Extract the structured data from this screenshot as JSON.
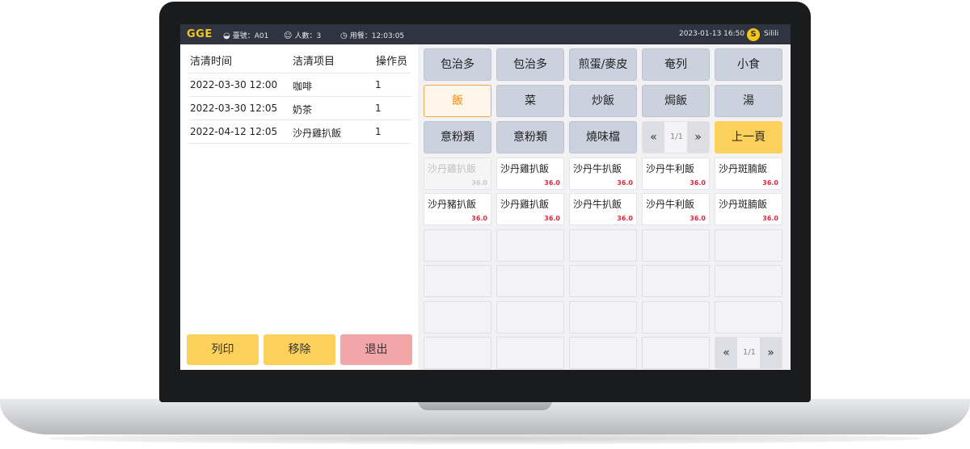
{
  "header": {
    "brand": "GGE",
    "table": "臺號：A01",
    "people": "人數：3",
    "dining_time": "用餐：12:03:05",
    "datetime": "2023-01-13 16:50",
    "user_initial": "S",
    "user_name": "Silili"
  },
  "log": {
    "columns": [
      "洁清时间",
      "洁清项目",
      "操作员"
    ],
    "rows": [
      {
        "time": "2022-03-30 12:00",
        "item": "咖啡",
        "operator": "1"
      },
      {
        "time": "2022-03-30 12:05",
        "item": "奶茶",
        "operator": "1"
      },
      {
        "time": "2022-04-12 12:05",
        "item": "沙丹雞扒飯",
        "operator": "1"
      }
    ]
  },
  "actions": {
    "print": "列印",
    "remove": "移除",
    "exit": "退出"
  },
  "categories": [
    "包治多",
    "包治多",
    "煎蛋/麥皮",
    "奄列",
    "小食",
    "飯",
    "菜",
    "炒飯",
    "焗飯",
    "湯",
    "意粉類",
    "意粉類",
    "燒味檔"
  ],
  "active_category": "飯",
  "category_pager": {
    "prev": "«",
    "page": "1/1",
    "next": "»",
    "back_label": "上一頁"
  },
  "items": [
    {
      "name": "沙丹雞扒飯",
      "price": "36.0",
      "disabled": true
    },
    {
      "name": "沙丹雞扒飯",
      "price": "36.0",
      "disabled": false
    },
    {
      "name": "沙丹牛扒飯",
      "price": "36.0",
      "disabled": false
    },
    {
      "name": "沙丹牛利飯",
      "price": "36.0",
      "disabled": false
    },
    {
      "name": "沙丹斑腩飯",
      "price": "36.0",
      "disabled": false
    },
    {
      "name": "沙丹豬扒飯",
      "price": "36.0",
      "disabled": false
    },
    {
      "name": "沙丹雞扒飯",
      "price": "36.0",
      "disabled": false
    },
    {
      "name": "沙丹牛扒飯",
      "price": "36.0",
      "disabled": false
    },
    {
      "name": "沙丹牛利飯",
      "price": "36.0",
      "disabled": false
    },
    {
      "name": "沙丹斑腩飯",
      "price": "36.0",
      "disabled": false
    }
  ],
  "item_pager": {
    "prev": "«",
    "page": "1/1",
    "next": "»"
  },
  "colors": {
    "topbar": "#2f3440",
    "brand": "#f5c518",
    "price": "#e2263c",
    "active": "#f08c1a",
    "category": "#ccd1de",
    "yellow_button": "#fbd15b",
    "exit_button": "#f2a6a8"
  }
}
